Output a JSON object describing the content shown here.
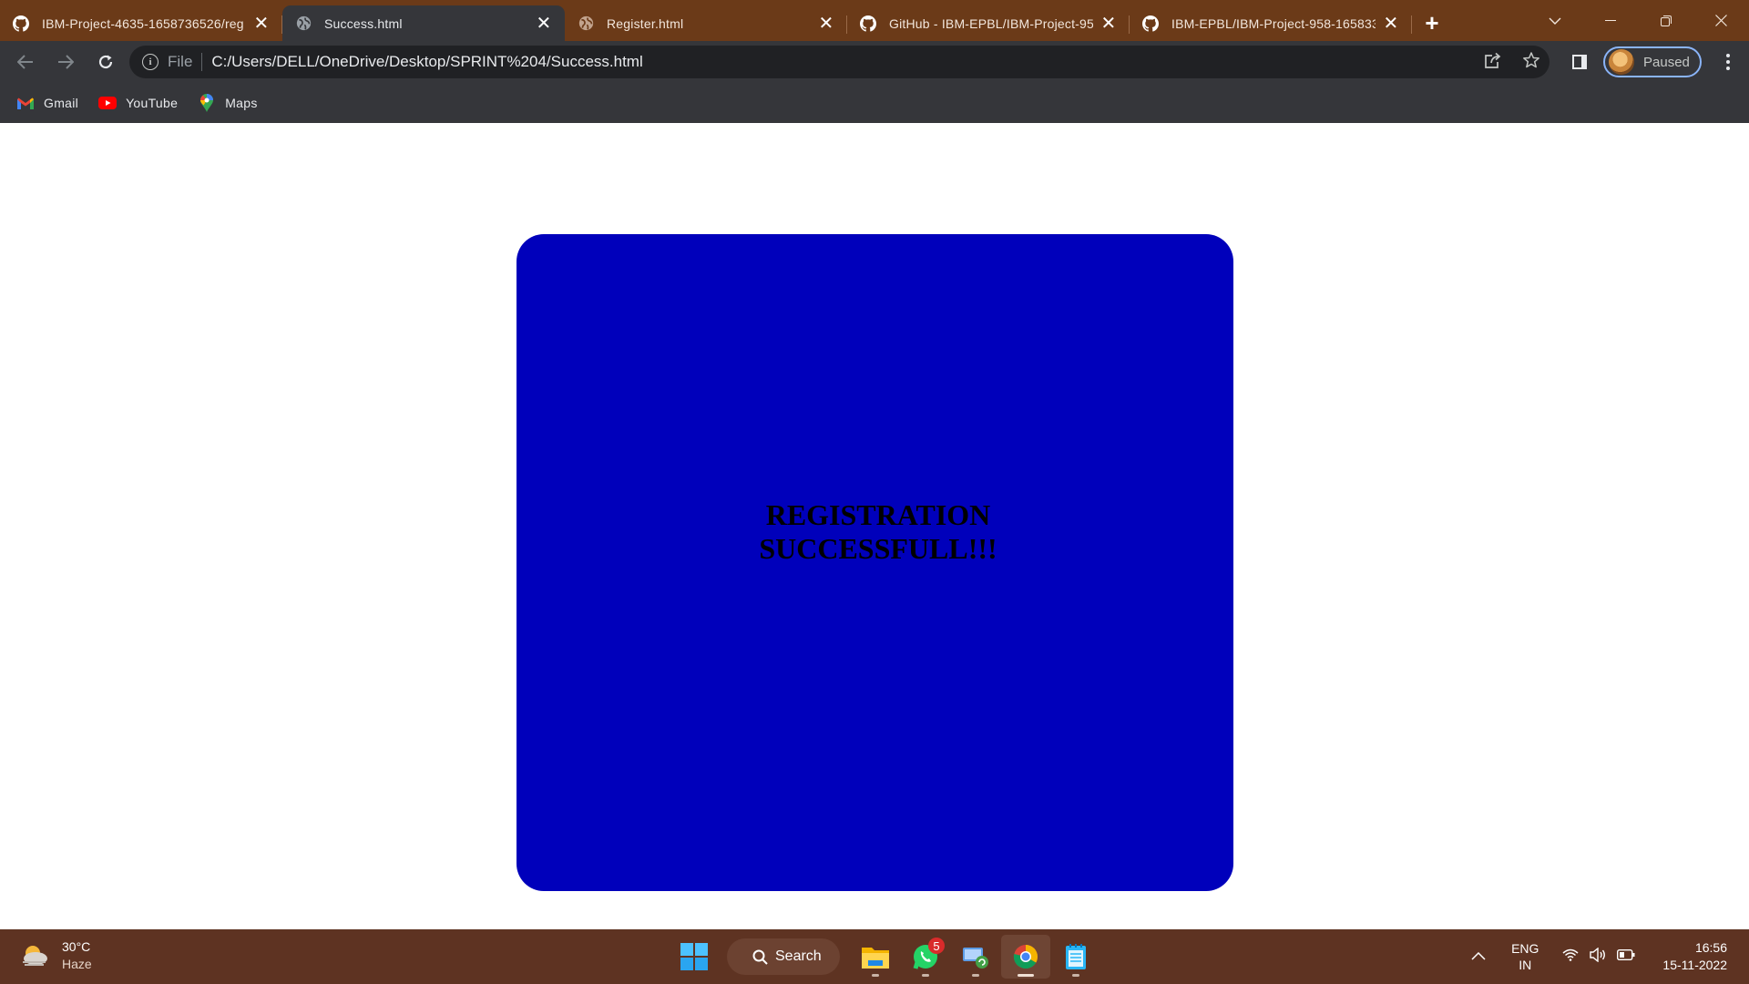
{
  "browser": {
    "tabs": [
      {
        "title": "IBM-Project-4635-1658736526/reg",
        "icon": "github-icon",
        "active": false
      },
      {
        "title": "Success.html",
        "icon": "globe-icon",
        "active": true
      },
      {
        "title": "Register.html",
        "icon": "globe-icon",
        "active": false
      },
      {
        "title": "GitHub - IBM-EPBL/IBM-Project-95",
        "icon": "github-icon",
        "active": false
      },
      {
        "title": "IBM-EPBL/IBM-Project-958-165833",
        "icon": "github-icon",
        "active": false
      }
    ],
    "address": {
      "scheme": "File",
      "url": "C:/Users/DELL/OneDrive/Desktop/SPRINT%204/Success.html"
    },
    "profile_label": "Paused",
    "bookmarks": [
      {
        "label": "Gmail",
        "icon": "gmail-icon"
      },
      {
        "label": "YouTube",
        "icon": "youtube-icon"
      },
      {
        "label": "Maps",
        "icon": "maps-icon"
      }
    ]
  },
  "page": {
    "message": "REGISTRATION SUCCESSFULL!!!",
    "card_color": "#0000bb"
  },
  "taskbar": {
    "weather": {
      "temp": "30°C",
      "condition": "Haze"
    },
    "search_label": "Search",
    "whatsapp_badge": "5",
    "tray": {
      "lang_top": "ENG",
      "lang_bottom": "IN",
      "time": "16:56",
      "date": "15-11-2022"
    }
  }
}
